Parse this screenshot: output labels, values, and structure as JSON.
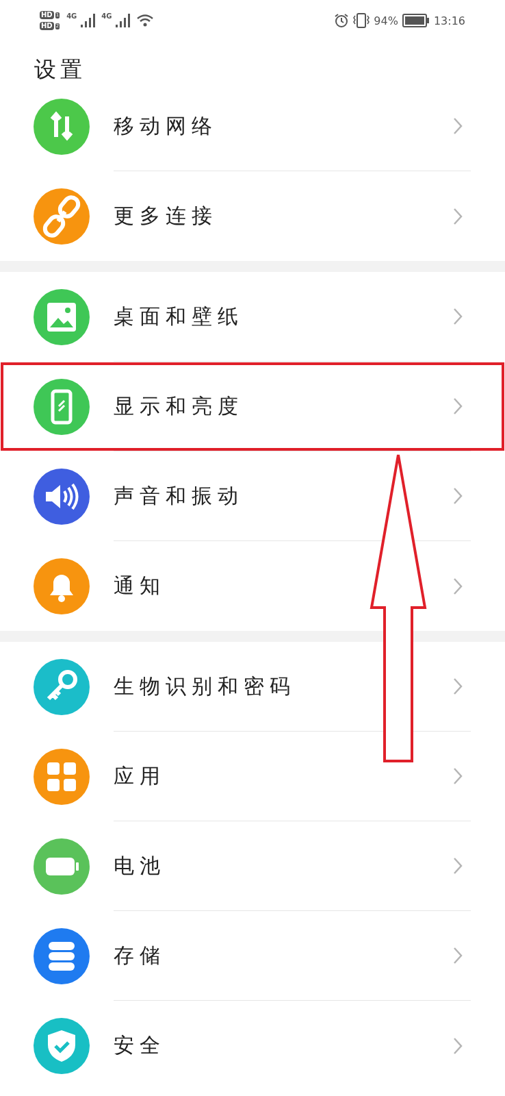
{
  "status_bar": {
    "sims": [
      {
        "label": "HD",
        "slot": "1"
      },
      {
        "label": "HD",
        "slot": "2"
      }
    ],
    "networks": [
      "4G",
      "4G"
    ],
    "battery": "94%",
    "time": "13:16"
  },
  "title": "设置",
  "groups": [
    {
      "items": [
        {
          "label": "移动网络",
          "color": "#4cc84a",
          "highlighted": false
        },
        {
          "label": "更多连接",
          "color": "#f7940f",
          "highlighted": false
        }
      ]
    },
    {
      "items": [
        {
          "label": "桌面和壁纸",
          "color": "#3fc756",
          "highlighted": false
        },
        {
          "label": "显示和亮度",
          "color": "#3fc756",
          "highlighted": true
        },
        {
          "label": "声音和振动",
          "color": "#3f5ee0",
          "highlighted": false
        },
        {
          "label": "通知",
          "color": "#f7940f",
          "highlighted": false
        }
      ]
    },
    {
      "items": [
        {
          "label": "生物识别和密码",
          "color": "#1bbdc9",
          "highlighted": false
        },
        {
          "label": "应用",
          "color": "#f7940f",
          "highlighted": false
        },
        {
          "label": "电池",
          "color": "#5ac25a",
          "highlighted": false
        },
        {
          "label": "存储",
          "color": "#1f7bf0",
          "highlighted": false
        },
        {
          "label": "安全",
          "color": "#18bfc4",
          "highlighted": false
        }
      ]
    }
  ]
}
